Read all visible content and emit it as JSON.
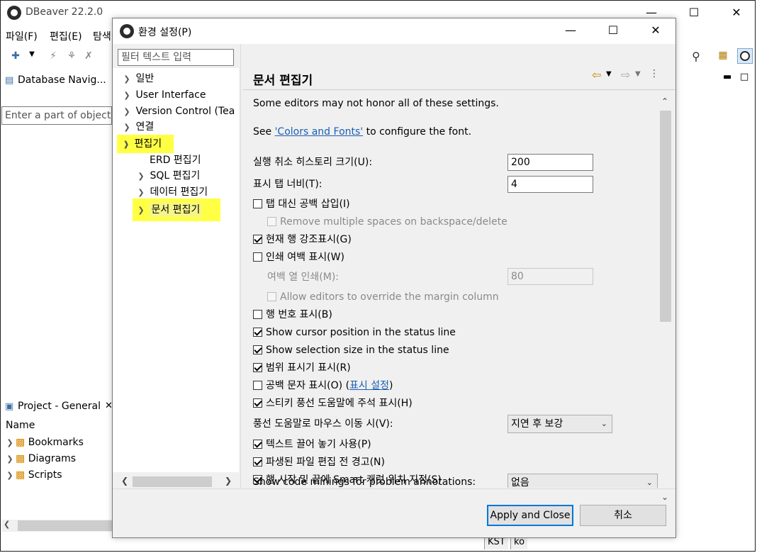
{
  "main_window": {
    "title": "DBeaver 22.2.0",
    "menu": [
      "파일(F)",
      "편집(E)",
      "탐색"
    ],
    "navigator_tab": "Database Navig...",
    "navigator_search_placeholder": "Enter a part of object",
    "project_tab": "Project - General",
    "project_column": "Name",
    "project_items": [
      "Bookmarks",
      "Diagrams",
      "Scripts"
    ],
    "status": [
      "KST",
      "ko"
    ]
  },
  "dialog": {
    "title": "환경 설정(P)",
    "filter_placeholder": "필터 텍스트 입력",
    "tree": {
      "items": [
        {
          "label": "일반"
        },
        {
          "label": "User Interface"
        },
        {
          "label": "Version Control (Tea"
        },
        {
          "label": "연결"
        },
        {
          "label": "편집기"
        },
        {
          "label": "ERD 편집기"
        },
        {
          "label": "SQL 편집기"
        },
        {
          "label": "데이터 편집기"
        },
        {
          "label": "문서 편집기"
        }
      ]
    },
    "page_title": "문서 편집기",
    "note": "Some editors may not honor all of these settings.",
    "see_prefix": "See ",
    "see_link": "'Colors and Fonts'",
    "see_suffix": " to configure the font.",
    "undo_history_label": "실행 취소 히스토리 크기(U):",
    "undo_history_value": "200",
    "tab_width_label": "표시 탭 너비(T):",
    "tab_width_value": "4",
    "spaces_for_tabs": "탭 대신 공백 삽입(I)",
    "remove_spaces": "Remove multiple spaces on backspace/delete",
    "highlight_line": "현재 행 강조표시(G)",
    "print_margin": "인쇄 여백 표시(W)",
    "margin_column_label": "여백 열 인쇄(M):",
    "margin_column_value": "80",
    "allow_override_margin": "Allow editors to override the margin column",
    "line_numbers": "행 번호 표시(B)",
    "cursor_position": "Show cursor position in the status line",
    "selection_size": "Show selection size in the status line",
    "range_indicator": "범위 표시기 표시(R)",
    "whitespace_prefix": "공백 문자 표시(O) (",
    "whitespace_link": "표시 설정",
    "whitespace_suffix": ")",
    "sticky_hover": "스티키 풍선 도움말에 주석 표시(H)",
    "hover_mouse_label": "풍선 도움말로 마우스 이동 시(V):",
    "hover_mouse_value": "지연 후 보강",
    "drag_drop": "텍스트 끌어 놓기 사용(P)",
    "derived_warning": "파생된 파일 편집 전 경고(N)",
    "smart_caret": "행 시작 및 끝에 Smart 캐럿 위치 지정(S)",
    "code_minings_label": "Show code minings for problem annotations:",
    "code_minings_value": "없음",
    "apply_close": "Apply and Close",
    "cancel": "취소"
  }
}
